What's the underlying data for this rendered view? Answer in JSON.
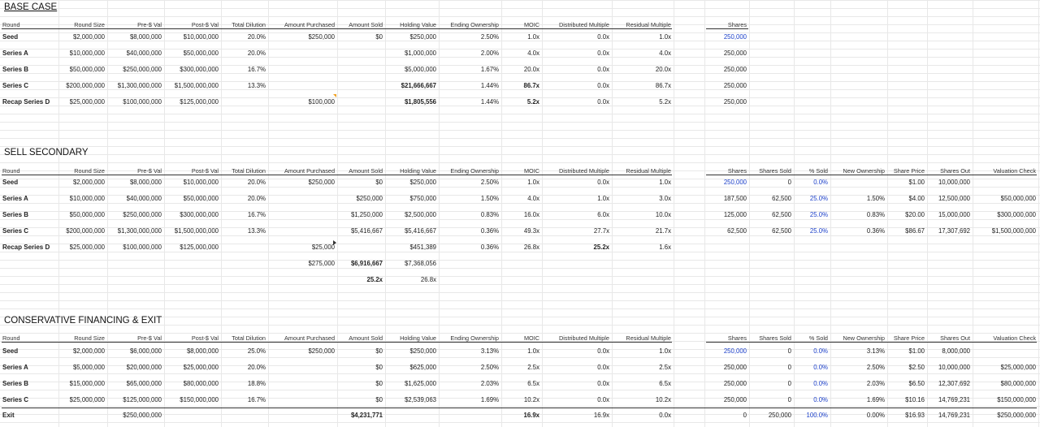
{
  "sections": [
    {
      "title": "BASE CASE",
      "underline": true,
      "headers": [
        "Round",
        "Round Size",
        "Pre-$ Val",
        "Post-$ Val",
        "Total Dilution",
        "Amount Purchased",
        "Amount Sold",
        "Holding Value",
        "Ending Ownership",
        "MOIC",
        "Distributed Multiple",
        "Residual Multiple",
        "",
        "Shares"
      ],
      "rows": [
        [
          "Seed",
          "$2,000,000",
          "$8,000,000",
          "$10,000,000",
          "20.0%",
          "$250,000",
          "$0",
          "$250,000",
          "2.50%",
          "1.0x",
          "0.0x",
          "1.0x",
          "",
          "250,000"
        ],
        [
          "Series A",
          "$10,000,000",
          "$40,000,000",
          "$50,000,000",
          "20.0%",
          "",
          "",
          "$1,000,000",
          "2.00%",
          "4.0x",
          "0.0x",
          "4.0x",
          "",
          "250,000"
        ],
        [
          "Series B",
          "$50,000,000",
          "$250,000,000",
          "$300,000,000",
          "16.7%",
          "",
          "",
          "$5,000,000",
          "1.67%",
          "20.0x",
          "0.0x",
          "20.0x",
          "",
          "250,000"
        ],
        [
          "Series C",
          "$200,000,000",
          "$1,300,000,000",
          "$1,500,000,000",
          "13.3%",
          "",
          "",
          "$21,666,667",
          "1.44%",
          "86.7x",
          "0.0x",
          "86.7x",
          "",
          "250,000"
        ],
        [
          "Recap Series D",
          "$25,000,000",
          "$100,000,000",
          "$125,000,000",
          "",
          "$100,000",
          "",
          "$1,805,556",
          "1.44%",
          "5.2x",
          "0.0x",
          "5.2x",
          "",
          "250,000"
        ]
      ],
      "totals": []
    },
    {
      "title": "SELL SECONDARY",
      "underline": false,
      "headers": [
        "Round",
        "Round Size",
        "Pre-$ Val",
        "Post-$ Val",
        "Total Dilution",
        "Amount Purchased",
        "Amount Sold",
        "Holding Value",
        "Ending Ownership",
        "MOIC",
        "Distributed Multiple",
        "Residual Multiple",
        "",
        "Shares",
        "Shares Sold",
        "% Sold",
        "New Ownership",
        "Share Price",
        "Shares Out",
        "Valuation Check"
      ],
      "rows": [
        [
          "Seed",
          "$2,000,000",
          "$8,000,000",
          "$10,000,000",
          "20.0%",
          "$250,000",
          "$0",
          "$250,000",
          "2.50%",
          "1.0x",
          "0.0x",
          "1.0x",
          "",
          "250,000",
          "0",
          "0.0%",
          "",
          "$1.00",
          "10,000,000",
          ""
        ],
        [
          "Series A",
          "$10,000,000",
          "$40,000,000",
          "$50,000,000",
          "20.0%",
          "",
          "$250,000",
          "$750,000",
          "1.50%",
          "4.0x",
          "1.0x",
          "3.0x",
          "",
          "187,500",
          "62,500",
          "25.0%",
          "1.50%",
          "$4.00",
          "12,500,000",
          "$50,000,000"
        ],
        [
          "Series B",
          "$50,000,000",
          "$250,000,000",
          "$300,000,000",
          "16.7%",
          "",
          "$1,250,000",
          "$2,500,000",
          "0.83%",
          "16.0x",
          "6.0x",
          "10.0x",
          "",
          "125,000",
          "62,500",
          "25.0%",
          "0.83%",
          "$20.00",
          "15,000,000",
          "$300,000,000"
        ],
        [
          "Series C",
          "$200,000,000",
          "$1,300,000,000",
          "$1,500,000,000",
          "13.3%",
          "",
          "$5,416,667",
          "$5,416,667",
          "0.36%",
          "49.3x",
          "27.7x",
          "21.7x",
          "",
          "62,500",
          "62,500",
          "25.0%",
          "0.36%",
          "$86.67",
          "17,307,692",
          "$1,500,000,000"
        ],
        [
          "Recap Series D",
          "$25,000,000",
          "$100,000,000",
          "$125,000,000",
          "",
          "$25,000",
          "",
          "$451,389",
          "0.36%",
          "26.8x",
          "25.2x",
          "1.6x",
          "",
          "",
          "",
          "",
          "",
          "",
          "",
          ""
        ]
      ],
      "totals": [
        [
          "",
          "",
          "",
          "",
          "",
          "$275,000",
          "$6,916,667",
          "$7,368,056",
          "",
          "",
          "",
          "",
          "",
          "",
          "",
          "",
          "",
          "",
          "",
          ""
        ],
        [
          "",
          "",
          "",
          "",
          "",
          "",
          "25.2x",
          "26.8x",
          "",
          "",
          "",
          "",
          "",
          "",
          "",
          "",
          "",
          "",
          "",
          ""
        ]
      ]
    },
    {
      "title": "CONSERVATIVE FINANCING & EXIT",
      "underline": false,
      "headers": [
        "Round",
        "Round Size",
        "Pre-$ Val",
        "Post-$ Val",
        "Total Dilution",
        "Amount Purchased",
        "Amount Sold",
        "Holding Value",
        "Ending Ownership",
        "MOIC",
        "Distributed Multiple",
        "Residual Multiple",
        "",
        "Shares",
        "Shares Sold",
        "% Sold",
        "New Ownership",
        "Share Price",
        "Shares Out",
        "Valuation Check"
      ],
      "rows": [
        [
          "Seed",
          "$2,000,000",
          "$6,000,000",
          "$8,000,000",
          "25.0%",
          "$250,000",
          "$0",
          "$250,000",
          "3.13%",
          "1.0x",
          "0.0x",
          "1.0x",
          "",
          "250,000",
          "0",
          "0.0%",
          "3.13%",
          "$1.00",
          "8,000,000",
          ""
        ],
        [
          "Series A",
          "$5,000,000",
          "$20,000,000",
          "$25,000,000",
          "20.0%",
          "",
          "$0",
          "$625,000",
          "2.50%",
          "2.5x",
          "0.0x",
          "2.5x",
          "",
          "250,000",
          "0",
          "0.0%",
          "2.50%",
          "$2.50",
          "10,000,000",
          "$25,000,000"
        ],
        [
          "Series B",
          "$15,000,000",
          "$65,000,000",
          "$80,000,000",
          "18.8%",
          "",
          "$0",
          "$1,625,000",
          "2.03%",
          "6.5x",
          "0.0x",
          "6.5x",
          "",
          "250,000",
          "0",
          "0.0%",
          "2.03%",
          "$6.50",
          "12,307,692",
          "$80,000,000"
        ],
        [
          "Series C",
          "$25,000,000",
          "$125,000,000",
          "$150,000,000",
          "16.7%",
          "",
          "$0",
          "$2,539,063",
          "1.69%",
          "10.2x",
          "0.0x",
          "10.2x",
          "",
          "250,000",
          "0",
          "0.0%",
          "1.69%",
          "$10.16",
          "14,769,231",
          "$150,000,000"
        ]
      ],
      "exit_row": [
        "Exit",
        "",
        "$250,000,000",
        "",
        "",
        "",
        "$4,231,771",
        "",
        "",
        "16.9x",
        "16.9x",
        "0.0x",
        "",
        "0",
        "250,000",
        "100.0%",
        "0.00%",
        "$16.93",
        "14,769,231",
        "$250,000,000"
      ],
      "totals": []
    }
  ],
  "colors": {
    "blue_input": "#1b3fc9",
    "grid": "#e8e8e8",
    "border": "#333333",
    "comment_marker": "#f0a020"
  }
}
